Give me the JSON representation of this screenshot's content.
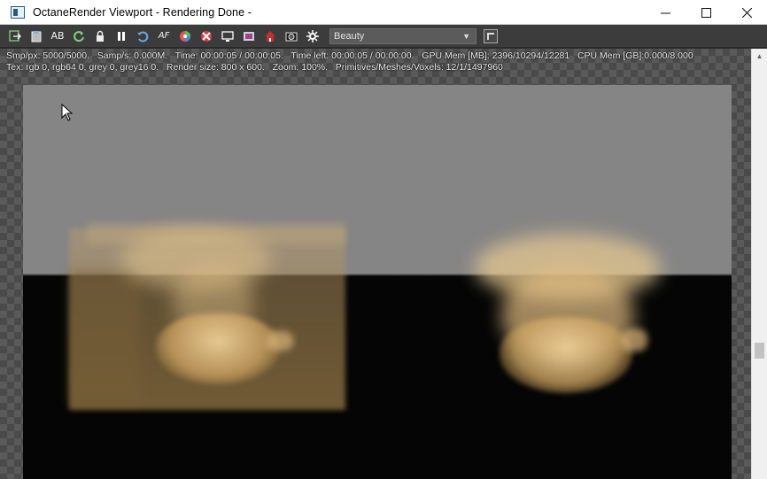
{
  "window": {
    "title": "OctaneRender Viewport - Rendering Done -",
    "controls": {
      "minimize": "—",
      "maximize": "☐",
      "close": "✕"
    }
  },
  "toolbar": {
    "buttons": [
      {
        "icon": "export-icon"
      },
      {
        "icon": "clipboard-icon"
      },
      {
        "icon": "ab-compare-icon",
        "label": "AB"
      },
      {
        "icon": "refresh-icon"
      },
      {
        "icon": "lock-icon"
      },
      {
        "icon": "pause-icon"
      },
      {
        "icon": "restart-icon"
      },
      {
        "icon": "focus-picker-icon",
        "label": "AF"
      },
      {
        "icon": "color-picker-icon"
      },
      {
        "icon": "material-picker-icon"
      },
      {
        "icon": "display-icon"
      },
      {
        "icon": "film-icon"
      },
      {
        "icon": "house-icon"
      },
      {
        "icon": "camera-icon"
      },
      {
        "icon": "settings-icon"
      }
    ],
    "render_pass": {
      "selected": "Beauty"
    }
  },
  "stats": {
    "line1": "Smp/px: 5000/5000.   Samp/s: 0.000M.   Time: 00:00:05 / 00:00:05.   Time left: 00:00:05 / 00:00:00.   GPU Mem [MB]: 2396/10294/12281   CPU Mem [GB]:0.000/8.000",
    "line2": "Tex: rgb 0, rgb64 0, grey 0, grey16 0.   Render size: 800 x 600.   Zoom: 100%.   Primitives/Meshes/Voxels: 12/1/1497960"
  },
  "colors": {
    "titlebar_bg": "#ffffff",
    "toolbar_bg": "#3c3c3c",
    "sky_gray": "#858585",
    "ground_black": "#050505",
    "smoke_gold": "#e0c28a"
  }
}
